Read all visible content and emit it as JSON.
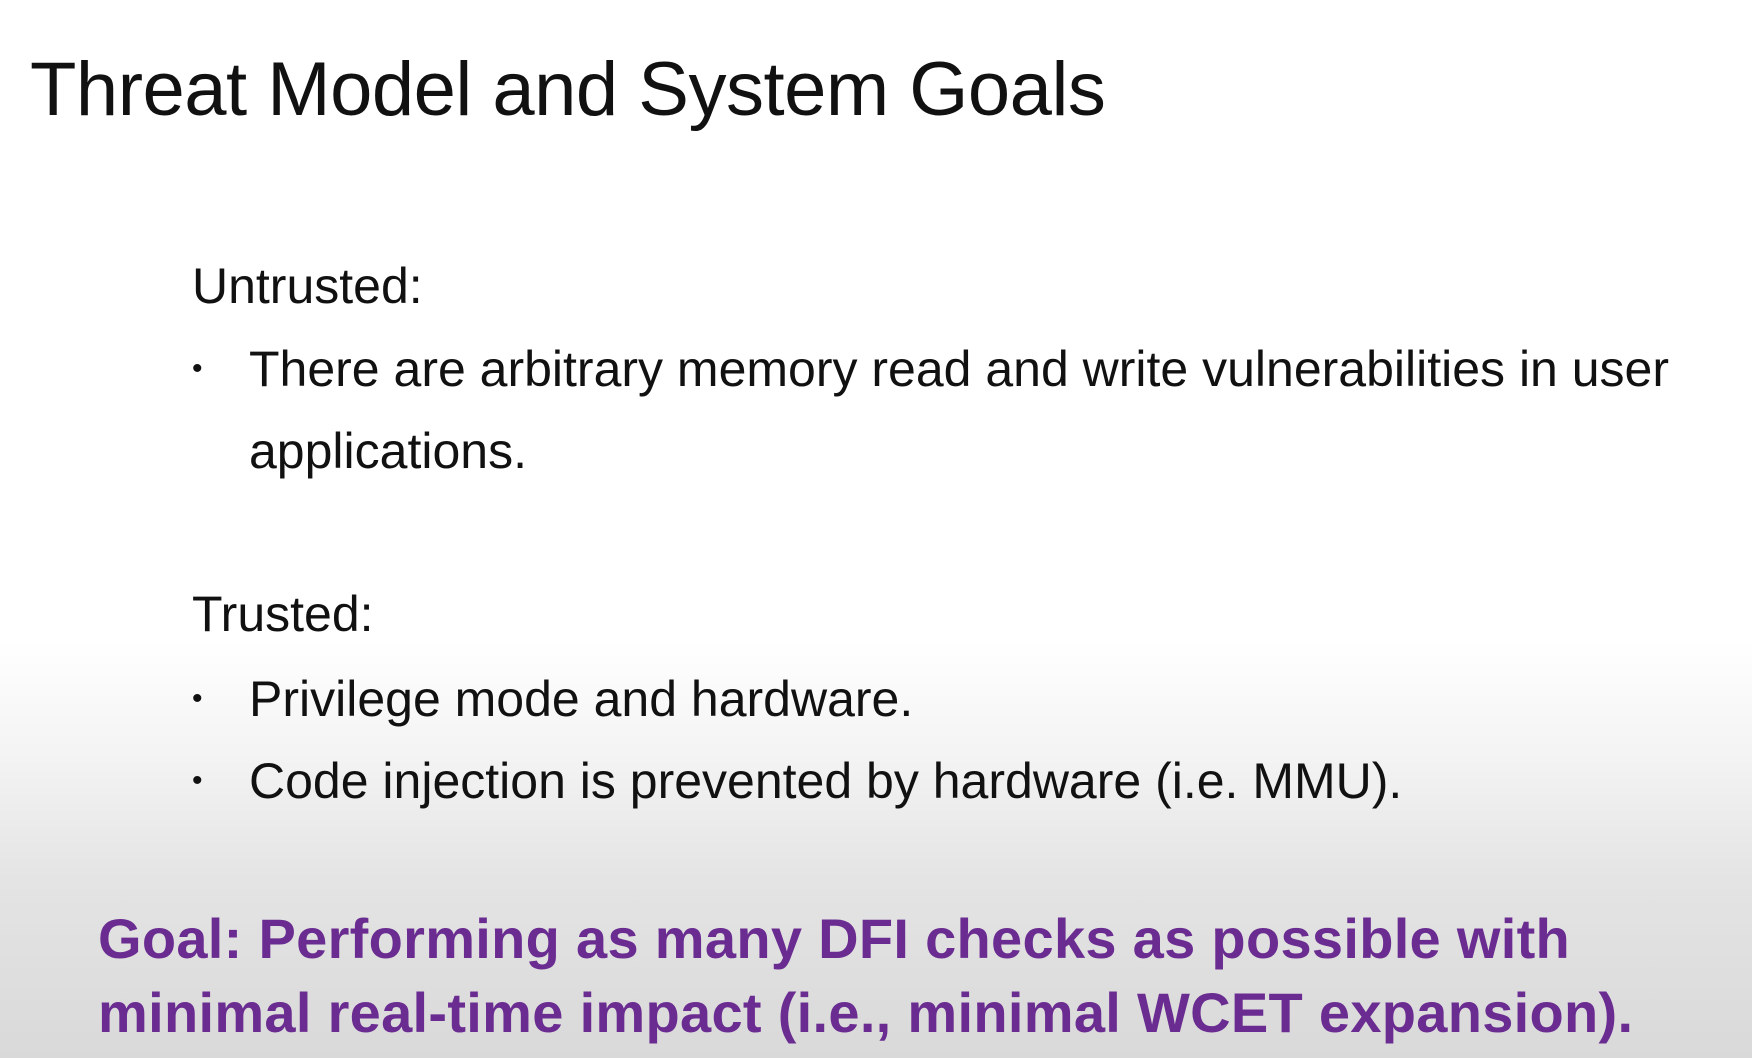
{
  "slide": {
    "title": "Threat Model and System Goals",
    "untrusted": {
      "heading": "Untrusted:",
      "bullets": [
        "There are arbitrary memory read and write vulnerabilities in user applications."
      ]
    },
    "trusted": {
      "heading": "Trusted:",
      "bullets": [
        "Privilege mode and hardware.",
        "Code injection is prevented by hardware (i.e. MMU)."
      ]
    },
    "goal": "Goal: Performing as many DFI checks as possible with minimal real-time impact (i.e., minimal WCET expansion).",
    "colors": {
      "goal_text": "#6a2c91",
      "body_text": "#111111"
    }
  }
}
